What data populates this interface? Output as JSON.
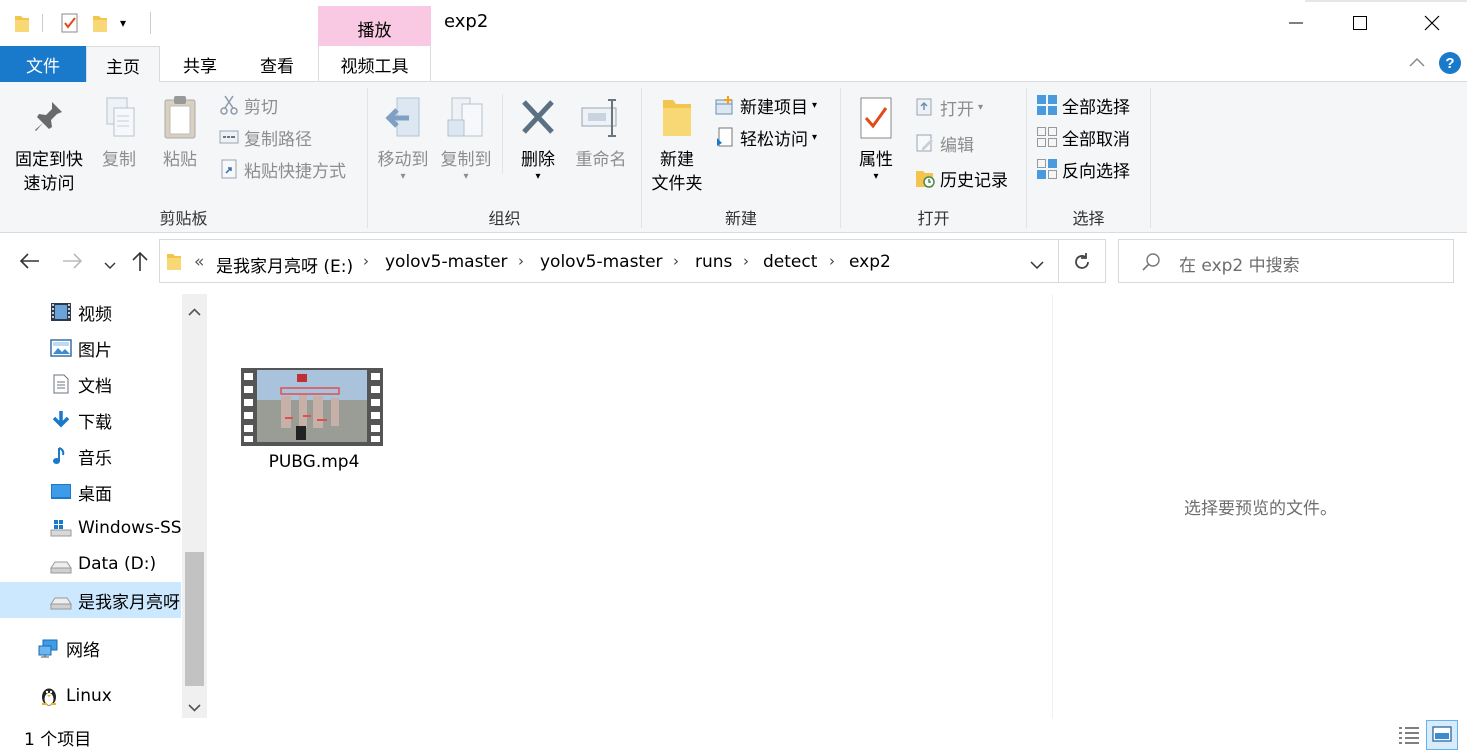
{
  "titlebar": {
    "title": "exp2",
    "context_tab": "播放",
    "window_buttons": [
      "minimize-icon",
      "maximize-icon",
      "close-icon"
    ]
  },
  "tabs": {
    "file": "文件",
    "home": "主页",
    "share": "共享",
    "view": "查看",
    "video_tools": "视频工具"
  },
  "ribbon": {
    "clipboard": {
      "group": "剪贴板",
      "pin_line1": "固定到快",
      "pin_line2": "速访问",
      "copy": "复制",
      "paste": "粘贴",
      "cut": "剪切",
      "copy_path": "复制路径",
      "paste_shortcut": "粘贴快捷方式"
    },
    "organize": {
      "group": "组织",
      "move_to": "移动到",
      "copy_to": "复制到",
      "delete": "删除",
      "rename": "重命名"
    },
    "new": {
      "group": "新建",
      "new_folder_line1": "新建",
      "new_folder_line2": "文件夹",
      "new_item": "新建项目",
      "easy_access": "轻松访问"
    },
    "open": {
      "group": "打开",
      "properties": "属性",
      "open": "打开",
      "edit": "编辑",
      "history": "历史记录"
    },
    "select": {
      "group": "选择",
      "select_all": "全部选择",
      "select_none": "全部取消",
      "invert": "反向选择"
    }
  },
  "address": {
    "overflow": "«",
    "crumbs": [
      "是我家月亮呀 (E:)",
      "yolov5-master",
      "yolov5-master",
      "runs",
      "detect",
      "exp2"
    ],
    "search_placeholder": "在 exp2 中搜索"
  },
  "nav": {
    "items": [
      "视频",
      "图片",
      "文档",
      "下载",
      "音乐",
      "桌面",
      "Windows-SSD",
      "Data (D:)",
      "是我家月亮呀 (E:)",
      "网络",
      "Linux"
    ],
    "selected_index": 8
  },
  "files": [
    {
      "name": "PUBG.mp4",
      "icon": "video-thumbnail-icon"
    }
  ],
  "preview": {
    "empty_text": "选择要预览的文件。"
  },
  "status": {
    "count": "1 个项目"
  },
  "colors": {
    "file_tab": "#1979ca",
    "context_tab": "#f9c8e2",
    "selected": "#cce8ff",
    "ribbon_bg": "#f5f6f7"
  }
}
